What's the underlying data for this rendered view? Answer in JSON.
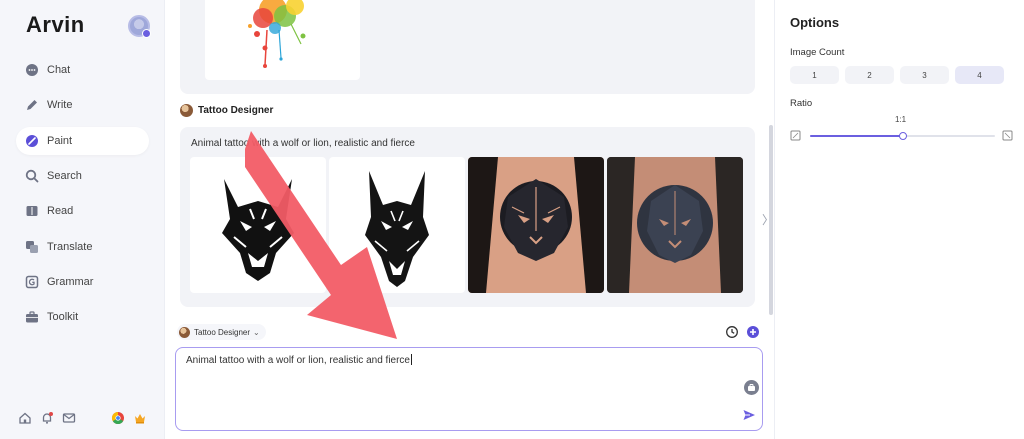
{
  "app": {
    "brand": "Arvin"
  },
  "sidebar": {
    "items": [
      {
        "label": "Chat",
        "icon": "chat-icon"
      },
      {
        "label": "Write",
        "icon": "write-icon"
      },
      {
        "label": "Paint",
        "icon": "paint-icon",
        "active": true
      },
      {
        "label": "Search",
        "icon": "search-icon"
      },
      {
        "label": "Read",
        "icon": "read-icon"
      },
      {
        "label": "Translate",
        "icon": "translate-icon"
      },
      {
        "label": "Grammar",
        "icon": "grammar-icon"
      },
      {
        "label": "Toolkit",
        "icon": "toolkit-icon"
      }
    ],
    "footer_icons": [
      "home-icon",
      "bell-icon",
      "mail-icon",
      "chrome-icon",
      "crown-icon"
    ]
  },
  "conversation": {
    "agent_name": "Tattoo Designer",
    "prompt": "Animal tattoo with a wolf or lion, realistic and fierce",
    "images": [
      "wolf-drawing-1",
      "wolf-drawing-2",
      "lion-arm-tattoo-1",
      "lion-arm-tattoo-2"
    ]
  },
  "composer": {
    "agent_label": "Tattoo Designer",
    "input_value": "Animal tattoo with a wolf or lion, realistic and fierce",
    "icons": [
      "history-icon",
      "new-chat-icon",
      "toolbox-icon",
      "send-icon"
    ]
  },
  "options": {
    "title": "Options",
    "image_count_label": "Image Count",
    "counts": [
      "1",
      "2",
      "3",
      "4"
    ],
    "selected_count": "4",
    "ratio_label": "Ratio",
    "ratio_value": "1:1",
    "ratio_slider_fraction": 0.5
  },
  "colors": {
    "accent": "#6b5fe0",
    "arrow": "#f25c66",
    "input_border": "#a89cf0"
  }
}
